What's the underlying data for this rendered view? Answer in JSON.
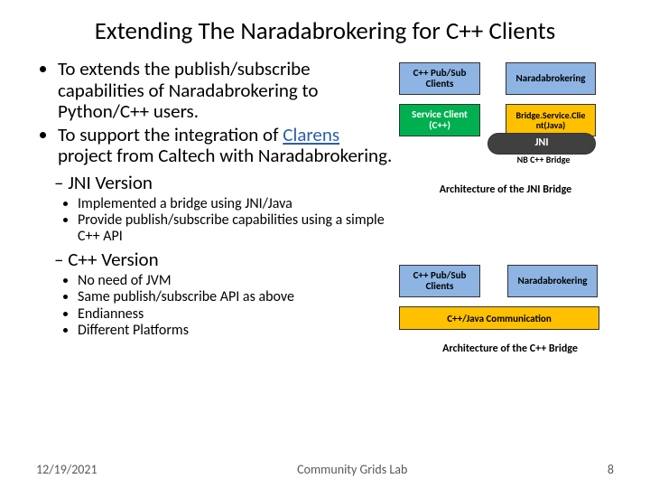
{
  "title": "Extending The Naradabrokering for C++ Clients",
  "bullets": {
    "b1": "To extends the publish/subscribe capabilities of Naradabrokering to Python/C++ users.",
    "b2a": "To support the integration of ",
    "b2link": "Clarens",
    "b2b": " project from Caltech with Naradabrokering.",
    "s1": "JNI Version",
    "s1a": "Implemented a bridge using JNI/Java",
    "s1b": "Provide publish/subscribe capabilities using a simple C++ API",
    "s2": "C++ Version",
    "s2a": "No need of JVM",
    "s2b": "Same publish/subscribe API as  above",
    "s2c": "Endianness",
    "s2d": "Different Platforms"
  },
  "dia": {
    "cpp": "C++ Pub/Sub Clients",
    "nb": "Naradabrokering",
    "svc": "Service Client (C++)",
    "bsc1": "Bridge.",
    "bsc2": "Service.Clie nt(Java)",
    "jni": "JNI",
    "nbc": "NB C++ Bridge",
    "cap1": "Architecture of the JNI Bridge",
    "comm": "C++/Java Communication",
    "cap2": "Architecture of the C++ Bridge"
  },
  "footer": {
    "date": "12/19/2021",
    "center": "Community Grids Lab",
    "page": "8"
  }
}
